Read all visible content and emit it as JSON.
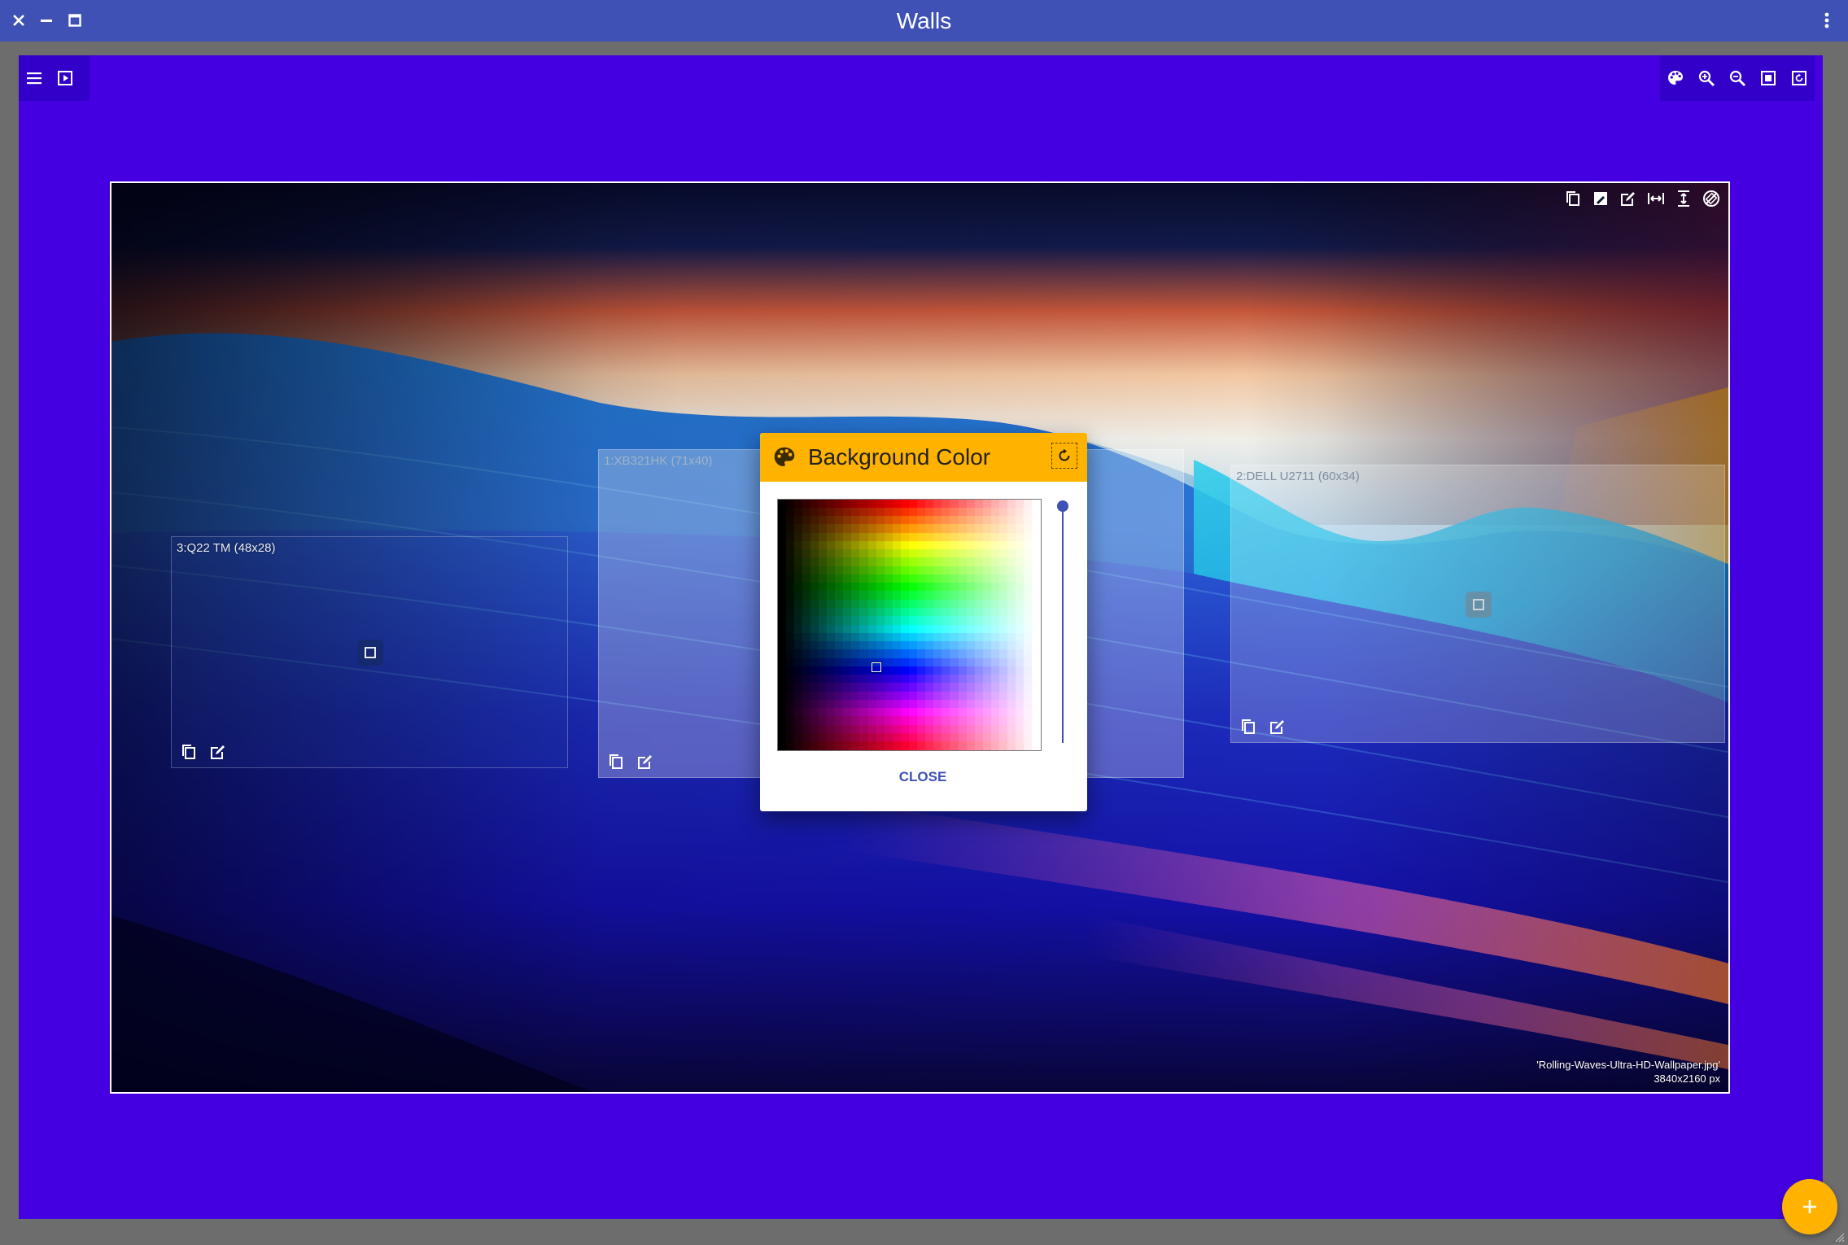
{
  "window": {
    "title": "Walls"
  },
  "titlebar": {
    "icons": [
      "close-icon",
      "minimize-icon",
      "maximize-icon",
      "more-vert-icon"
    ]
  },
  "toolbar_left": {
    "icons": [
      "menu-icon",
      "slideshow-icon"
    ]
  },
  "toolbar_right": {
    "icons": [
      "palette-icon",
      "zoom-in-icon",
      "zoom-out-icon",
      "fit-screen-icon",
      "reset-icon"
    ]
  },
  "wall": {
    "tools": [
      "copy-icon",
      "image-edit-icon",
      "edit-icon",
      "fit-width-icon",
      "fit-height-icon",
      "no-rotate-icon"
    ],
    "file_name": "'Rolling-Waves-Ultra-HD-Wallpaper.jpg'",
    "resolution": "3840x2160 px"
  },
  "displays": [
    {
      "label": "3:Q22 TM (48x28)"
    },
    {
      "label": "1:XB321HK (71x40)"
    },
    {
      "label": "2:DELL U2711 (60x34)"
    }
  ],
  "dialog": {
    "title": "Background Color",
    "close_label": "CLOSE",
    "selected_color": "#4400e0",
    "brightness_level": 1.0
  },
  "colors": {
    "titlebar": "#3f51b5",
    "canvas": "#4400e0",
    "accent": "#ffb300",
    "primary": "#3f51b5"
  }
}
